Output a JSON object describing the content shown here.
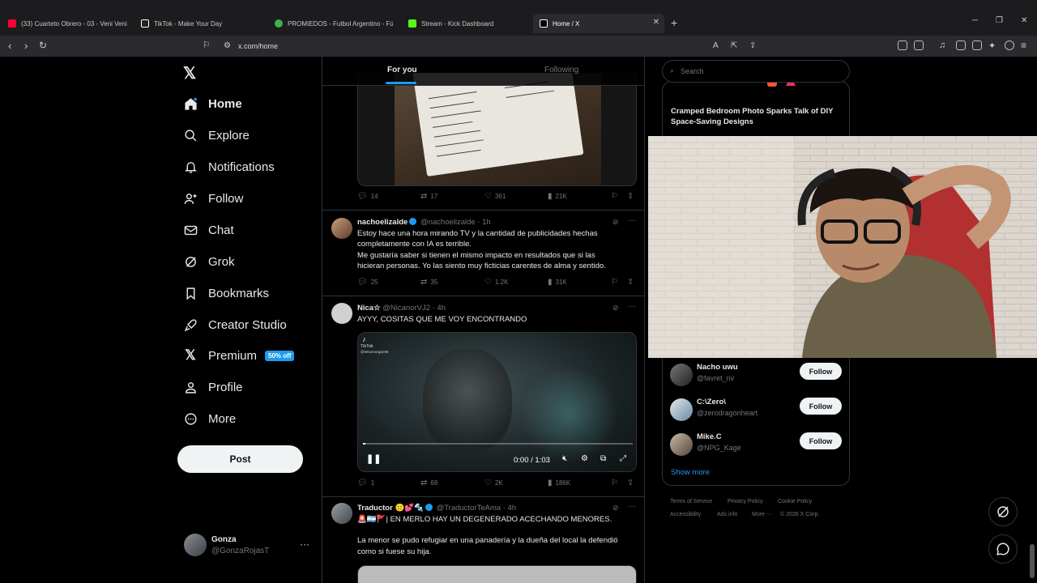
{
  "browser": {
    "tabs": [
      {
        "label": "(33) Cuarteto Obrero - 03 - Veni Veni",
        "color": "#ff0033"
      },
      {
        "label": "TikTok - Make Your Day",
        "color": "#ffffff"
      },
      {
        "label": "PROMIEDOS - Futbol Argentino - Fút",
        "color": "#3bb54a"
      },
      {
        "label": "Stream - Kick Dashboard",
        "color": "#53fc18"
      },
      {
        "label": "Home / X",
        "color": "#ffffff"
      }
    ],
    "url": "x.com/home"
  },
  "sidebar": {
    "items": [
      {
        "label": "Home",
        "icon": "home-icon"
      },
      {
        "label": "Explore",
        "icon": "search-icon"
      },
      {
        "label": "Notifications",
        "icon": "bell-icon"
      },
      {
        "label": "Follow",
        "icon": "person-add-icon"
      },
      {
        "label": "Chat",
        "icon": "mail-icon"
      },
      {
        "label": "Grok",
        "icon": "grok-icon"
      },
      {
        "label": "Bookmarks",
        "icon": "bookmark-icon"
      },
      {
        "label": "Creator Studio",
        "icon": "rocket-icon"
      },
      {
        "label": "Premium",
        "icon": "x-logo-icon"
      },
      {
        "label": "Profile",
        "icon": "person-icon"
      },
      {
        "label": "More",
        "icon": "more-circle-icon"
      }
    ],
    "premium_badge": "50% off",
    "post_label": "Post",
    "account": {
      "name": "Gonza",
      "handle": "@GonzaRojasT"
    }
  },
  "timeline": {
    "tabs": [
      "For you",
      "Following"
    ],
    "tweets": [
      {
        "stats": {
          "replies": "14",
          "reposts": "17",
          "likes": "361",
          "views": "21K"
        }
      },
      {
        "name": "nachoelizalde",
        "handle": "@nachoelizalde",
        "time": "· 1h",
        "lines": [
          "Estoy hace una hora mirando TV y la cantidad de publicidades hechas",
          "completamente con IA es terrible.",
          "Me gustaría saber si tienen el mismo impacto en resultados que si las",
          "hicieran personas. Yo las siento muy ficticias carentes de alma y sentido."
        ],
        "stats": {
          "replies": "25",
          "reposts": "35",
          "likes": "1.2K",
          "views": "31K"
        }
      },
      {
        "name": "Nica☆",
        "handle": "@NicanorVJ2",
        "time": "· 4h",
        "lines": [
          "AYYY, COSITAS QUE ME VOY ENCONTRANDO"
        ],
        "video": {
          "watermark": "TikTok",
          "watermark_handle": "@letsomorgan95",
          "time": "0:00 / 1:03",
          "progress": 0.01
        },
        "stats": {
          "replies": "1",
          "reposts": "68",
          "likes": "2K",
          "views": "186K"
        }
      },
      {
        "name": "Traductor 🙂💕🔩",
        "handle": "@TraductorTeAma",
        "time": "· 4h",
        "lines": [
          "🚨🇦🇷🚩| EN MERLO HAY UN DEGENERADO ACECHANDO MENORES.",
          "",
          "La menor se pudo refugiar en una panadería y la dueña del local la defendió",
          "como si fuese su hija."
        ]
      }
    ]
  },
  "right": {
    "search_placeholder": "Search",
    "trend_title": "Cramped Bedroom Photo Sparks Talk of DIY Space-Saving Designs",
    "who_to_follow": [
      {
        "name": "Nacho uwu",
        "handle": "@favret_nv"
      },
      {
        "name": "C:\\Zero\\",
        "handle": "@zerodragonheart"
      },
      {
        "name": "Mike.C",
        "handle": "@NPG_Kage"
      }
    ],
    "follow_label": "Follow",
    "show_more": "Show more",
    "footer": [
      "Terms of Service",
      "Privacy Policy",
      "Cookie Policy",
      "Accessibility",
      "Ads info",
      "More ···",
      "© 2026 X Corp."
    ]
  },
  "colors": {
    "accent": "#1d9bf0",
    "bg": "#000000",
    "border": "#2f3336",
    "muted": "#71767b"
  }
}
